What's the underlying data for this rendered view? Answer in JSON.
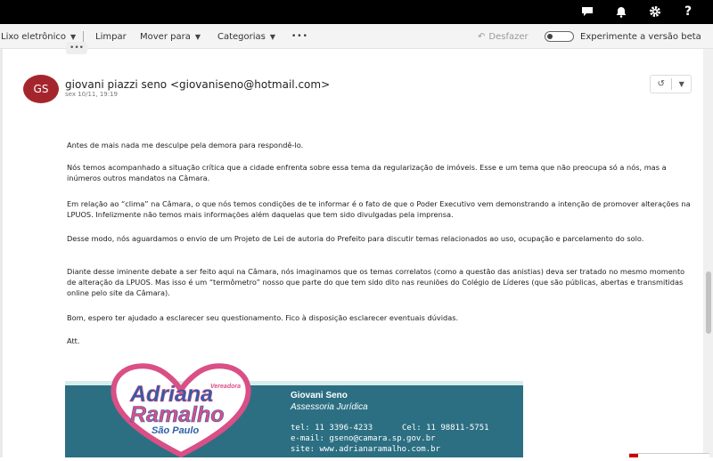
{
  "topbar": {
    "icons": [
      "chat-icon",
      "bell-icon",
      "gear-icon",
      "help-icon"
    ],
    "help_glyph": "?"
  },
  "toolbar": {
    "junk_label": "Lixo eletrônico",
    "clean_label": "Limpar",
    "move_label": "Mover para",
    "categories_label": "Categorias",
    "more_label": "•••",
    "undo_label": "Desfazer",
    "beta_label": "Experimente a versão beta"
  },
  "message": {
    "more_dots": "•••",
    "avatar_initials": "GS",
    "avatar_color": "#a4262c",
    "sender": "giovani piazzi seno <giovaniseno@hotmail.com>",
    "date": "sex 10/11, 19:19",
    "body": [
      "Antes de mais nada me desculpe pela demora para respondê-lo.",
      "Nós temos acompanhado a situação crítica que a cidade enfrenta sobre essa tema da regularização de imóveis. Esse e um tema que não preocupa só a nós, mas a inúmeros outros mandatos na Câmara.",
      "Em relação ao “clima” na Câmara, o que nós temos condições de te informar é o fato de que o Poder Executivo vem demonstrando a intenção de promover alterações na LPUOS. Infelizmente não temos mais informações além daquelas que tem sido divulgadas pela imprensa.",
      "Desse modo, nós aguardamos o envio de um Projeto de Lei de autoria do Prefeito para discutir temas relacionados ao uso, ocupação e parcelamento do solo.",
      "Diante desse iminente debate a ser feito aqui na Câmara, nós imaginamos que os temas correlatos (como a questão das anistias) deva ser tratado no mesmo momento de alteração da LPUOS. Mas isso é um “termômetro” nosso que parte do que tem sido dito nas reuniões do Colégio de Líderes (que são públicas, abertas e transmitidas online pelo site da Câmara).",
      "Bom, espero ter ajudado a esclarecer seu questionamento. Fico à disposição esclarecer eventuais dúvidas.",
      "Att."
    ]
  },
  "signature": {
    "logo": {
      "top": "Vereadora",
      "line1": "Adriana",
      "line2": "Ramalho",
      "line3": "São Paulo"
    },
    "name": "Giovani Seno",
    "role": "Assessoria Jurídica",
    "tel": "tel: 11 3396-4233",
    "cel": "Cel: 11 98811-5751",
    "email": "e-mail: gseno@camara.sp.gov.br",
    "site": "site: www.adrianaramalho.com.br",
    "band_color": "#2c6f83",
    "logo_pink": "#d94f86",
    "logo_blue": "#2c5fa8"
  }
}
